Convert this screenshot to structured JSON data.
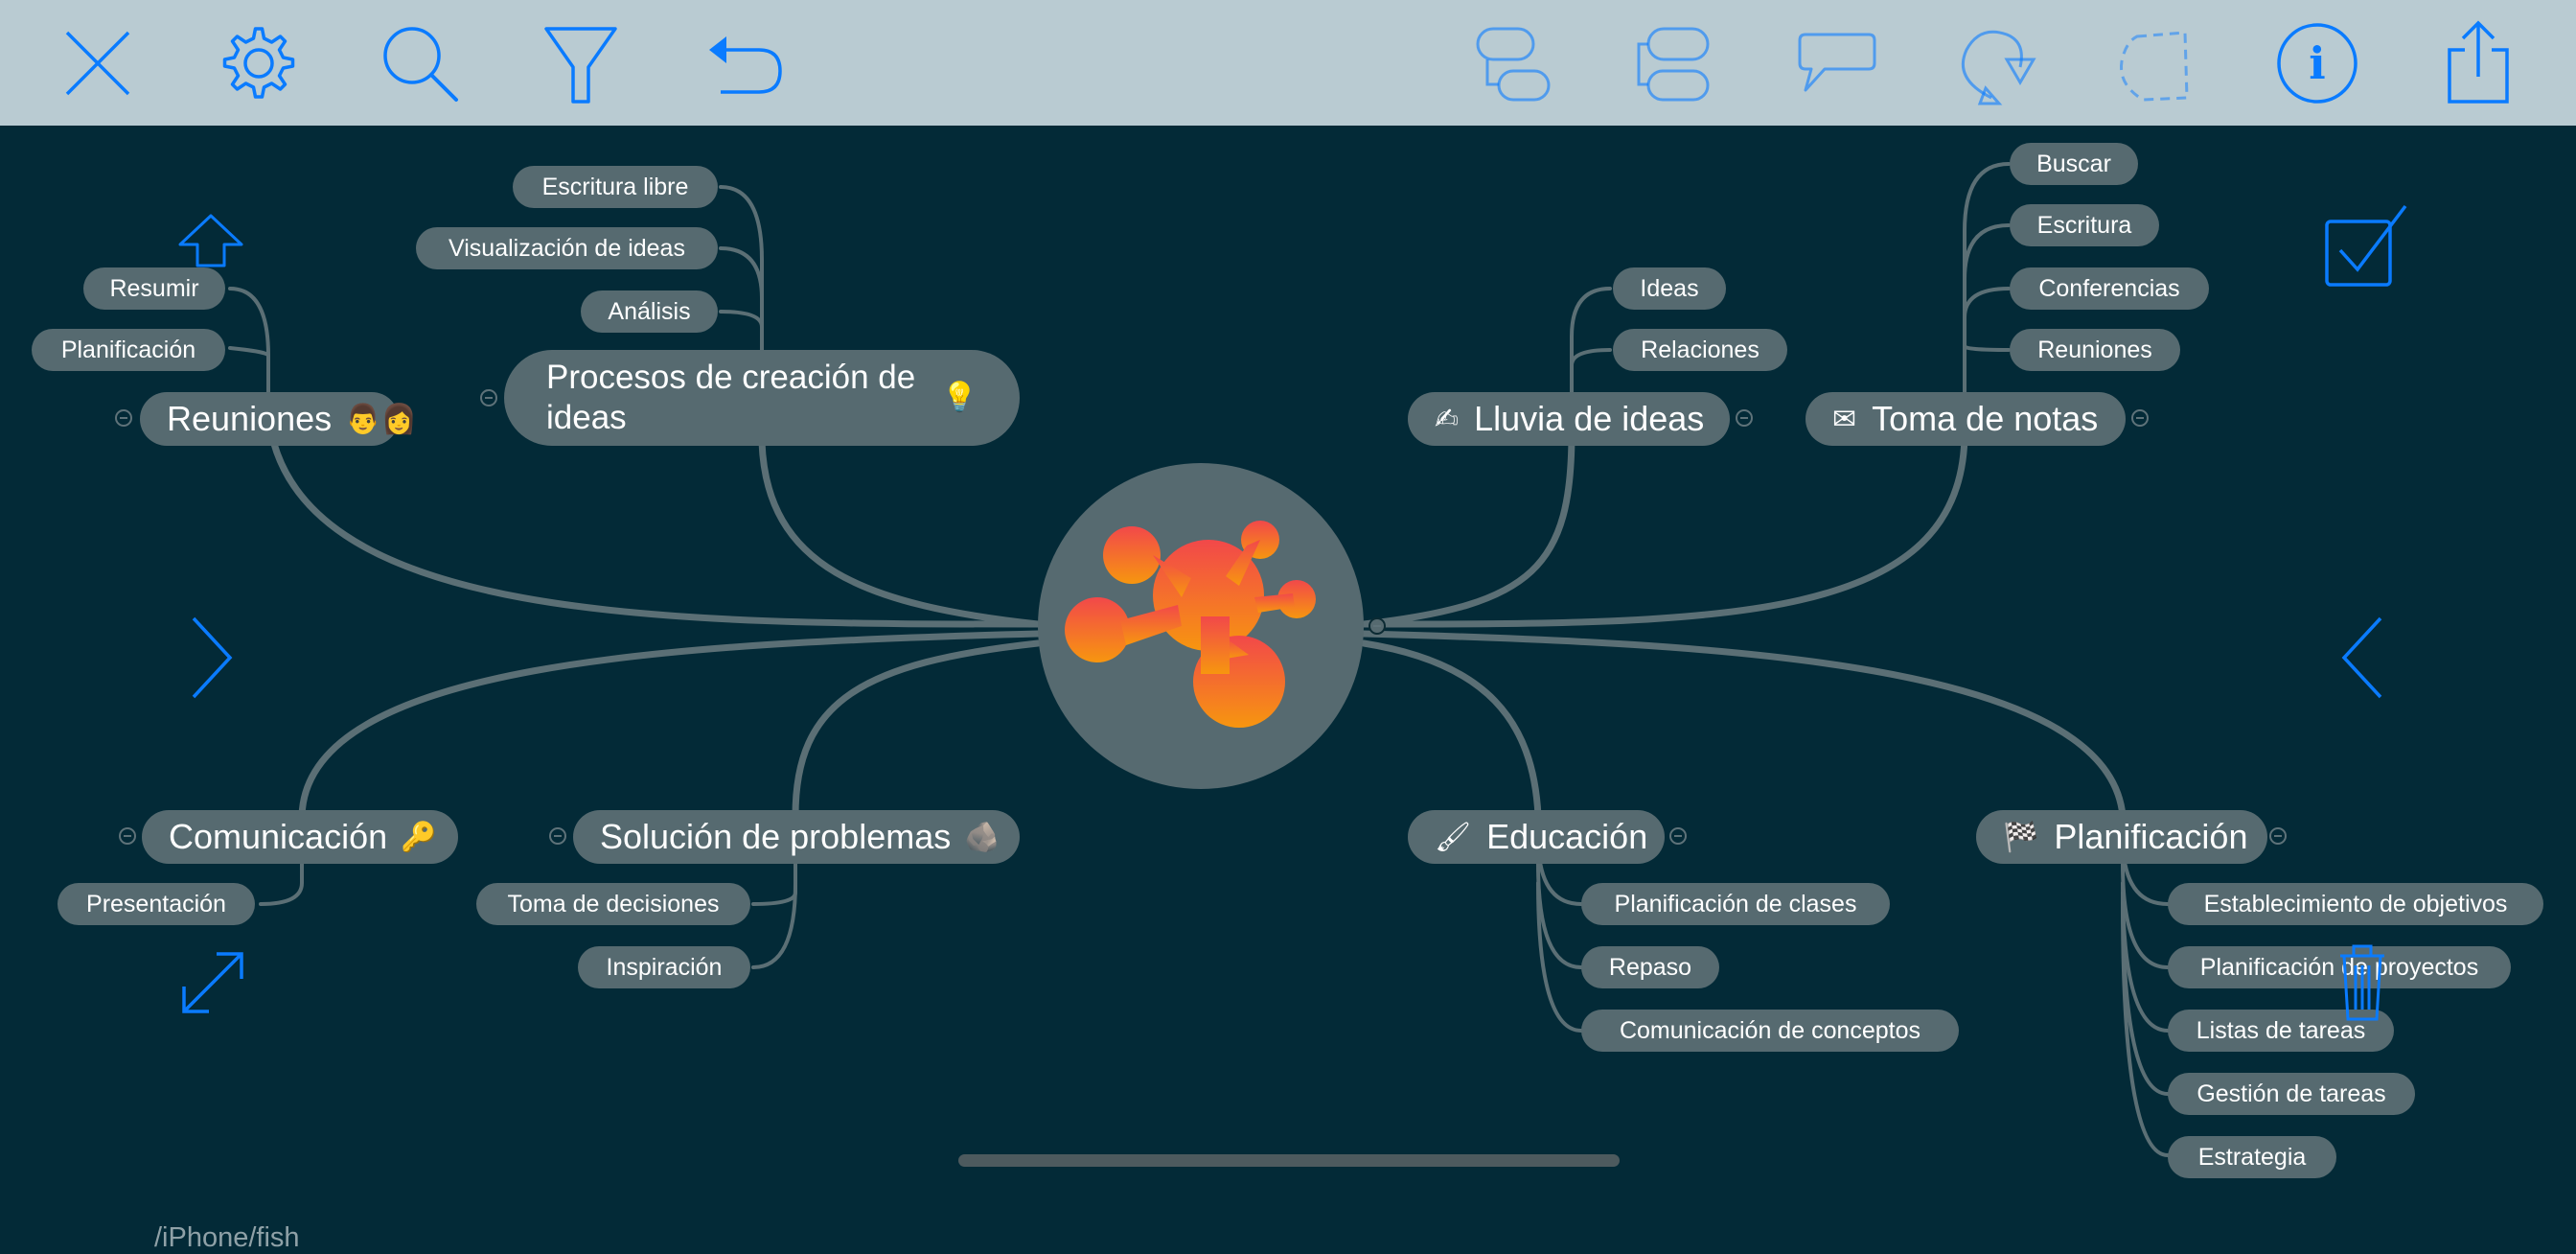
{
  "toolbar": {
    "left": [
      {
        "icon": "close-icon"
      },
      {
        "icon": "gear-icon"
      },
      {
        "icon": "search-icon"
      },
      {
        "icon": "filter-icon"
      },
      {
        "icon": "undo-icon"
      }
    ],
    "right": [
      {
        "icon": "add-subtopic-icon"
      },
      {
        "icon": "add-sibling-icon"
      },
      {
        "icon": "add-callout-icon"
      },
      {
        "icon": "add-relation-icon"
      },
      {
        "icon": "add-boundary-icon"
      },
      {
        "icon": "info-icon"
      },
      {
        "icon": "share-icon"
      }
    ],
    "accent": "#0a7bff"
  },
  "colors": {
    "background": "#032a37",
    "node": "#566a70",
    "link": "#5b6f75",
    "accent": "#0a7bff"
  },
  "topics": {
    "reuniones": {
      "label": "Reuniones",
      "emoji": "👨‍👩",
      "children": [
        "Resumir",
        "Planificación"
      ]
    },
    "procesos": {
      "label": "Procesos de creación de ideas",
      "emoji": "💡",
      "children": [
        "Escritura libre",
        "Visualización de ideas",
        "Análisis"
      ]
    },
    "lluvia": {
      "label": "Lluvia de ideas",
      "emoji": "✍",
      "children": [
        "Ideas",
        "Relaciones"
      ]
    },
    "notas": {
      "label": "Toma de notas",
      "emoji": "✉",
      "children": [
        "Buscar",
        "Escritura",
        "Conferencias",
        "Reuniones"
      ]
    },
    "comunicacion": {
      "label": "Comunicación",
      "emoji": "🔑",
      "children": [
        "Presentación"
      ]
    },
    "solucion": {
      "label": "Solución de problemas",
      "emoji": "🪨",
      "children": [
        "Toma de decisiones",
        "Inspiración"
      ]
    },
    "educacion": {
      "label": "Educación",
      "emoji": "🖌",
      "children": [
        "Planificación de clases",
        "Repaso",
        "Comunicación de conceptos"
      ]
    },
    "planificacion": {
      "label": "Planificación",
      "emoji": "🏁",
      "children": [
        "Establecimiento de objetivos",
        "Planificación de proyectos",
        "Listas de tareas",
        "Gestión de tareas",
        "Estrategia"
      ]
    }
  },
  "side_icons": {
    "up": "arrow-up-icon",
    "right": "chevron-right-icon",
    "left": "chevron-left-icon",
    "expand": "expand-icon",
    "check": "checkbox-icon",
    "trash": "trash-icon"
  },
  "footer": {
    "path": "/iPhone/fish"
  }
}
